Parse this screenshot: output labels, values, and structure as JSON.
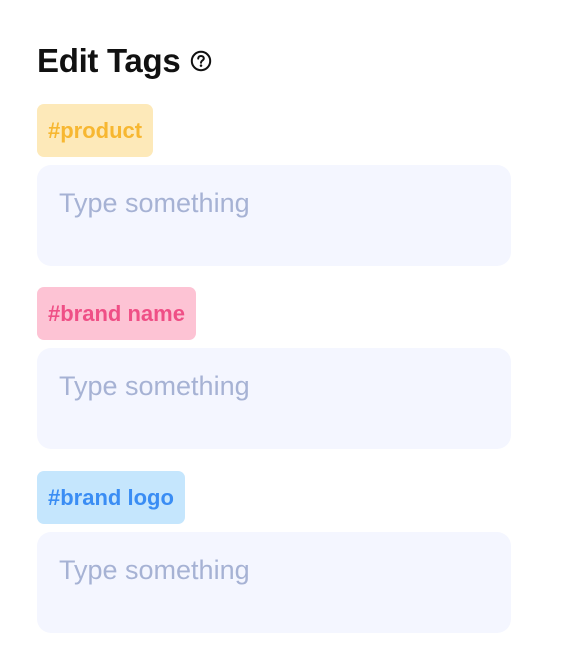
{
  "header": {
    "title": "Edit Tags",
    "help_icon": "question-circle-icon"
  },
  "tags": [
    {
      "label": "#product",
      "text_color": "#f7b731",
      "bg_color": "#fde9b9",
      "input_value": "",
      "input_placeholder": "Type something"
    },
    {
      "label": "#brand name",
      "text_color": "#ef4f86",
      "bg_color": "#fdc3d4",
      "input_value": "",
      "input_placeholder": "Type something"
    },
    {
      "label": "#brand logo",
      "text_color": "#3a8df4",
      "bg_color": "#c5e6fd",
      "input_value": "",
      "input_placeholder": "Type something"
    }
  ]
}
